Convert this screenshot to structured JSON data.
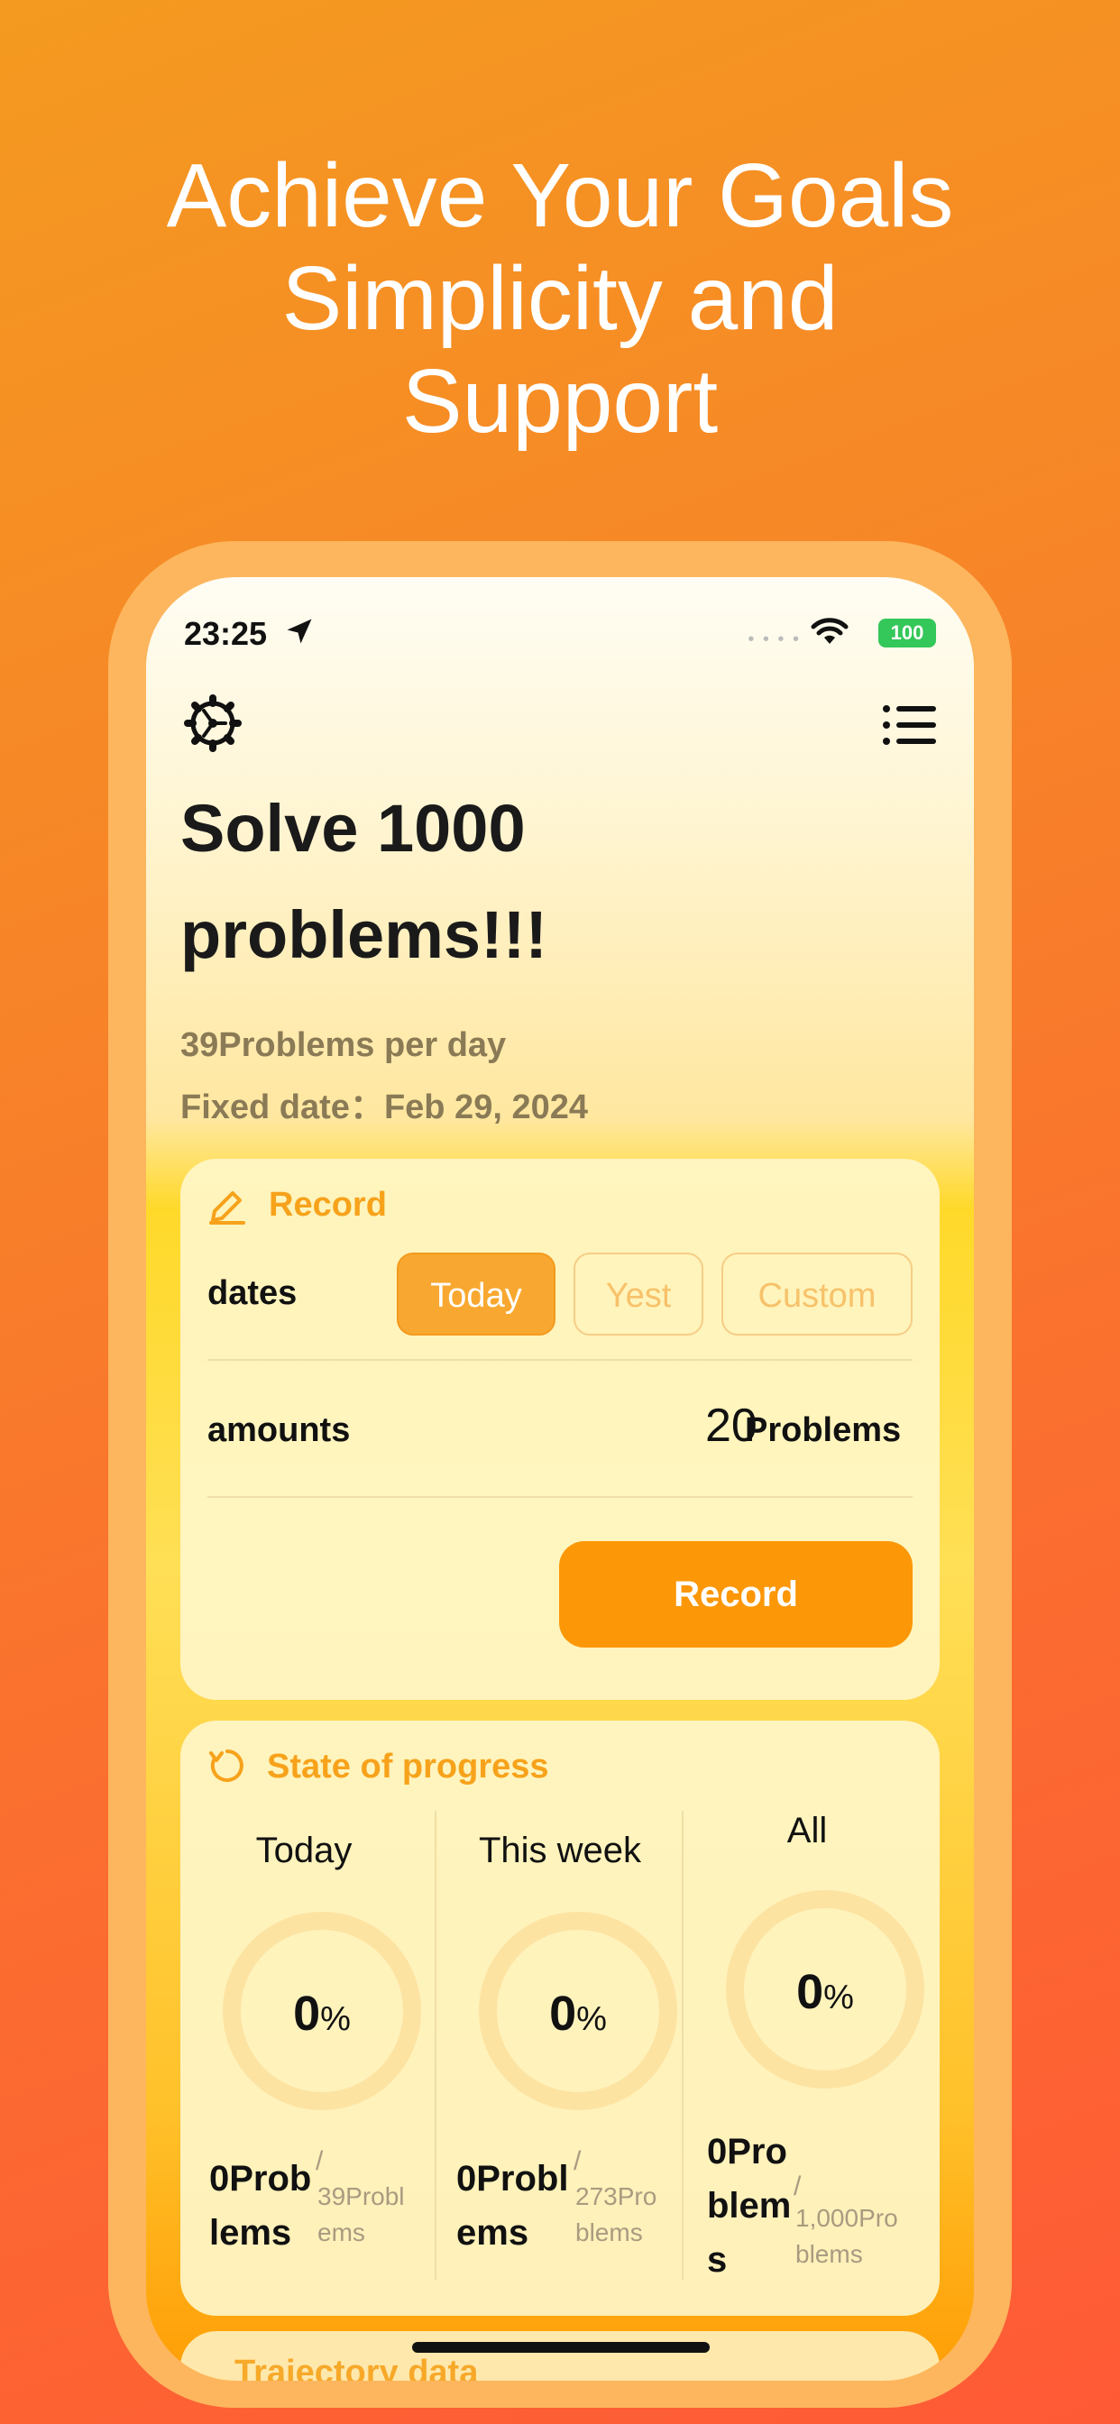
{
  "headline": {
    "line1": "Achieve Your Goals",
    "line2": "Simplicity and",
    "line3": "Support"
  },
  "status_bar": {
    "time": "23:25",
    "battery": "100",
    "location_icon": "location-arrow-icon",
    "wifi_icon": "wifi-icon"
  },
  "top_bar": {
    "settings_icon": "gear-icon",
    "menu_icon": "list-icon"
  },
  "goal": {
    "title_line1": "Solve 1000",
    "title_line2": "problems!!!",
    "per_day": "39Problems per day",
    "fixed_date": "Fixed date：Feb 29, 2024"
  },
  "record_card": {
    "heading": "Record",
    "icon": "pencil-icon",
    "dates_label": "dates",
    "date_options": [
      "Today",
      "Yest",
      "Custom"
    ],
    "selected_date": "Today",
    "amounts_label": "amounts",
    "amount_value": "20",
    "amount_unit": "Problems",
    "record_button": "Record"
  },
  "progress_card": {
    "heading": "State of progress",
    "icon": "refresh-icon",
    "columns": [
      {
        "title": "Today",
        "percent": "0",
        "pct_sign": "%",
        "done_line1": "0Prob",
        "done_line2": "lems",
        "slash": "/",
        "target_line1": "39Probl",
        "target_line2": "ems"
      },
      {
        "title": "This week",
        "percent": "0",
        "pct_sign": "%",
        "done_line1": "0Probl",
        "done_line2": "ems",
        "slash": "/",
        "target_line1": "273Pro",
        "target_line2": "blems"
      },
      {
        "title": "All",
        "percent": "0",
        "pct_sign": "%",
        "done_line1": "0Pro",
        "done_line2": "blem",
        "done_line3": "s",
        "slash": "/",
        "target_line1": "1,000Pro",
        "target_line2": "blems"
      }
    ]
  },
  "next_card": {
    "heading": "Trajectory data"
  },
  "colors": {
    "accent": "#fc9707",
    "accent_text": "#f7a21b",
    "ring": "#fde3a2",
    "battery": "#34c759"
  }
}
